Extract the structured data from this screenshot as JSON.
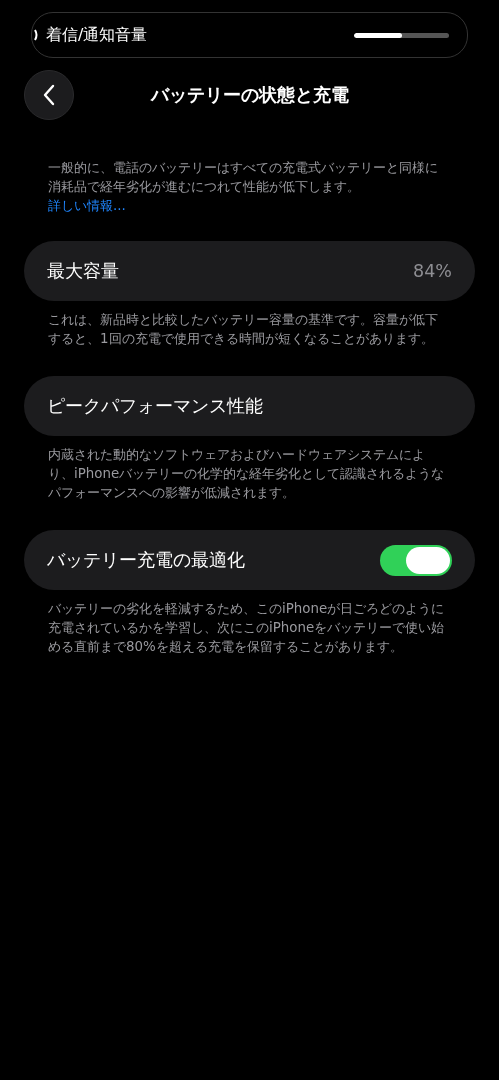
{
  "volume_hud": {
    "label": "着信/通知音量",
    "level": 0.5
  },
  "nav": {
    "title": "バッテリーの状態と充電"
  },
  "intro": {
    "text": "一般的に、電話のバッテリーはすべての充電式バッテリーと同様に消耗品で経年劣化が進むにつれて性能が低下します。",
    "link": "詳しい情報..."
  },
  "sections": [
    {
      "kind": "value",
      "label": "最大容量",
      "value": "84%",
      "footer": "これは、新品時と比較したバッテリー容量の基準です。容量が低下すると、1回の充電で使用できる時間が短くなることがあります。"
    },
    {
      "kind": "plain",
      "label": "ピークパフォーマンス性能",
      "footer": "内蔵された動的なソフトウェアおよびハードウェアシステムにより、iPhoneバッテリーの化学的な経年劣化として認識されるようなパフォーマンスへの影響が低減されます。"
    },
    {
      "kind": "toggle",
      "label": "バッテリー充電の最適化",
      "on": true,
      "footer": "バッテリーの劣化を軽減するため、このiPhoneが日ごろどのように充電されているかを学習し、次にこのiPhoneをバッテリーで使い始める直前まで80%を超える充電を保留することがあります。"
    }
  ]
}
